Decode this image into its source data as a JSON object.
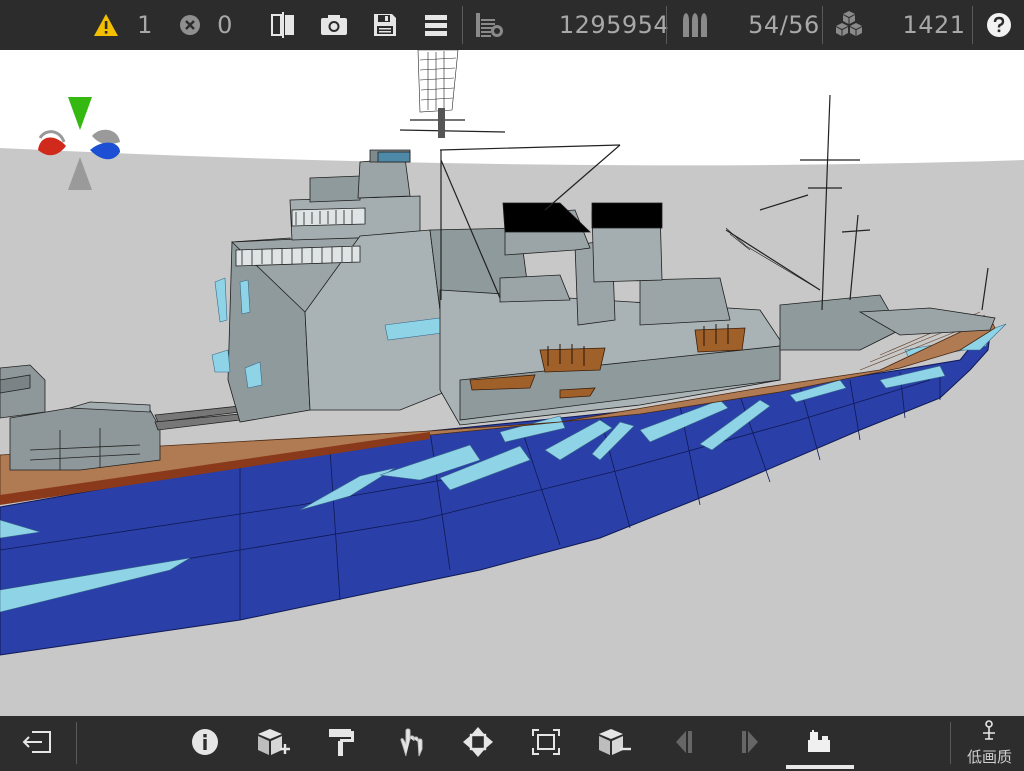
{
  "toolbar": {
    "warning_count": "1",
    "error_count": "0",
    "polygon_count": "1295954",
    "ammo_count": "54/56",
    "parts_count": "1421"
  },
  "bottom": {
    "quality_label": "低画质"
  },
  "icons": {
    "warning": "warning-icon",
    "error": "error-icon",
    "compare": "compare-icon",
    "camera": "camera-icon",
    "save": "save-icon",
    "menu": "menu-icon",
    "weight": "weight-icon",
    "ammo": "ammo-icon",
    "parts": "parts-icon",
    "help": "help-icon",
    "exit": "exit-icon",
    "info": "info-icon",
    "add_part": "add-part-icon",
    "paint": "paint-icon",
    "touch": "touch-icon",
    "move": "move-icon",
    "scale": "scale-icon",
    "remove_part": "remove-part-icon",
    "prev": "prev-icon",
    "next": "next-icon",
    "dock": "dock-icon",
    "quality": "quality-icon"
  },
  "colors": {
    "hull_blue": "#2a3fa6",
    "camo_light": "#8fd3e6",
    "superstructure": "#8f9a9c",
    "deck": "#b07a52",
    "axis_x": "#d02a1c",
    "axis_y": "#35b80f",
    "axis_z": "#1c4fd4"
  }
}
